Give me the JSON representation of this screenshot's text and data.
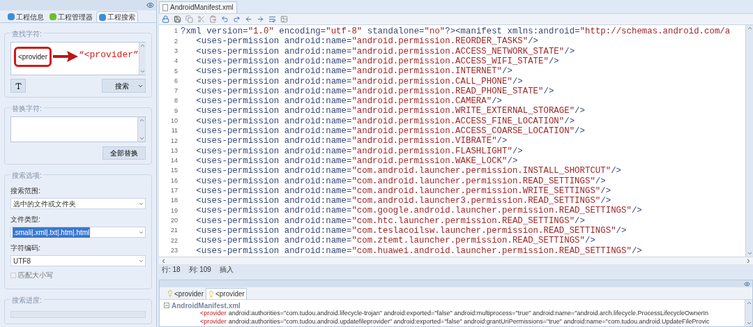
{
  "left_panel": {
    "tabs": [
      {
        "label": "工程信息",
        "selected": false,
        "color": "#3b8fd8"
      },
      {
        "label": "工程管理器",
        "selected": false,
        "color": "#6cbf2a"
      },
      {
        "label": "工程搜索",
        "selected": true,
        "color": "#3b8fd8"
      }
    ],
    "find": {
      "label": "查找字符:",
      "value": "<provider",
      "button": "搜索"
    },
    "replace": {
      "label": "替换字符:",
      "button": "全部替换"
    },
    "options": {
      "title": "搜索选项:",
      "fields": [
        {
          "label": "搜索范围:",
          "value": "选中的文件或文件夹",
          "highlighted": false
        },
        {
          "label": "文件类型:",
          "value": ".smali|.xml|.txt|.htm|.html",
          "highlighted": true
        },
        {
          "label": "字符编码:",
          "value": "UTF8",
          "highlighted": false
        }
      ],
      "match_case": {
        "label": "匹配大小写",
        "checked": false
      }
    },
    "progress": {
      "title": "搜索进度:",
      "level": 0
    }
  },
  "editor": {
    "file_tab": "AndroidManifest.xml",
    "lines": [
      {
        "number": "1",
        "text": "?xml version=\"1.0\" encoding=\"utf-8\" standalone=\"no\"?><manifest xmlns:android=\"http://schemas.android.com/a"
      },
      {
        "number": "2",
        "text": "   <uses-permission android:name=\"android.permission.REORDER_TASKS\"/>"
      },
      {
        "number": "3",
        "text": "   <uses-permission android:name=\"android.permission.ACCESS_NETWORK_STATE\"/>"
      },
      {
        "number": "4",
        "text": "   <uses-permission android:name=\"android.permission.ACCESS_WIFI_STATE\"/>"
      },
      {
        "number": "5",
        "text": "   <uses-permission android:name=\"android.permission.INTERNET\"/>"
      },
      {
        "number": "6",
        "text": "   <uses-permission android:name=\"android.permission.CALL_PHONE\"/>"
      },
      {
        "number": "7",
        "text": "   <uses-permission android:name=\"android.permission.READ_PHONE_STATE\"/>"
      },
      {
        "number": "8",
        "text": "   <uses-permission android:name=\"android.permission.CAMERA\"/>"
      },
      {
        "number": "9",
        "text": "   <uses-permission android:name=\"android.permission.WRITE_EXTERNAL_STORAGE\"/>"
      },
      {
        "number": "10",
        "text": "   <uses-permission android:name=\"android.permission.ACCESS_FINE_LOCATION\"/>"
      },
      {
        "number": "11",
        "text": "   <uses-permission android:name=\"android.permission.ACCESS_COARSE_LOCATION\"/>"
      },
      {
        "number": "12",
        "text": "   <uses-permission android:name=\"android.permission.VIBRATE\"/>"
      },
      {
        "number": "13",
        "text": "   <uses-permission android:name=\"android.permission.FLASHLIGHT\"/>"
      },
      {
        "number": "14",
        "text": "   <uses-permission android:name=\"android.permission.WAKE_LOCK\"/>"
      },
      {
        "number": "15",
        "text": "   <uses-permission android:name=\"com.android.launcher.permission.INSTALL_SHORTCUT\"/>"
      },
      {
        "number": "16",
        "text": "   <uses-permission android:name=\"com.android.launcher.permission.READ_SETTINGS\"/>"
      },
      {
        "number": "17",
        "text": "   <uses-permission android:name=\"com.android.launcher.permission.WRITE_SETTINGS\"/>"
      },
      {
        "number": "18",
        "text": "   <uses-permission android:name=\"com.android.launcher3.permission.READ_SETTINGS\"/>"
      },
      {
        "number": "19",
        "text": "   <uses-permission android:name=\"com.google.android.launcher.permission.READ_SETTINGS\"/>"
      },
      {
        "number": "20",
        "text": "   <uses-permission android:name=\"com.htc.launcher.permission.READ_SETTINGS\"/>"
      },
      {
        "number": "21",
        "text": "   <uses-permission android:name=\"com.teslacoilsw.launcher.permission.READ_SETTINGS\"/>"
      },
      {
        "number": "22",
        "text": "   <uses-permission android:name=\"com.ztemt.launcher.permission.READ_SETTINGS\"/>"
      },
      {
        "number": "23",
        "text": "   <uses-permission android:name=\"com.huawei.android.launcher.permission.READ_SETTINGS\"/>"
      }
    ],
    "status": {
      "line": "行: 18",
      "column": "列: 109",
      "mode": "插入"
    }
  },
  "results": {
    "tabs": [
      {
        "label": "<provider",
        "selected": false
      },
      {
        "label": "<provider",
        "selected": true
      }
    ],
    "file": "AndroidManifest.xml",
    "matches": [
      {
        "tag": "<provider",
        "text": "android:authorities=\"com.tudou.android.lifecycle-trojan\" android:exported=\"false\" android:multiprocess=\"true\" android:name=\"android.arch.lifecycle.ProcessLifecycleOwnerIn"
      },
      {
        "tag": "<provider",
        "text": "android:authorities=\"com.tudou.android.updatefileprovider\" android:exported=\"false\" android:grantUriPermissions=\"true\" android:name=\"com.tudou.android.UpdateFileProvic"
      }
    ]
  },
  "annotation": {
    "callout": "“<provider”"
  }
}
